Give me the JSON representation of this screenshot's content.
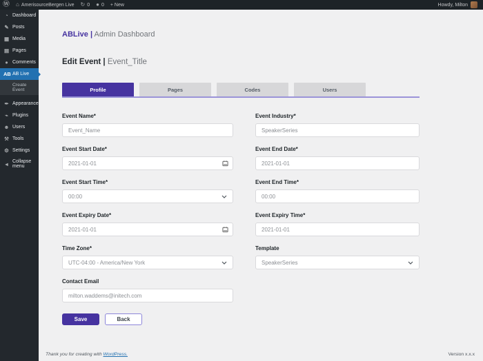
{
  "admin_bar": {
    "wp_logo_glyph": "Ⓦ",
    "home_icon_glyph": "⌂",
    "site_name": "AmerisourceBergen Live",
    "updates_icon_glyph": "↻",
    "updates_count": "0",
    "comments_icon_glyph": "●",
    "comments_count": "0",
    "new_label": "+ New",
    "howdy": "Howdy, Milton"
  },
  "sidebar": {
    "items": [
      {
        "icon": "◔",
        "label": "Dashboard"
      },
      {
        "icon": "✎",
        "label": "Posts"
      },
      {
        "icon": "▦",
        "label": "Media"
      },
      {
        "icon": "▤",
        "label": "Pages"
      },
      {
        "icon": "●",
        "label": "Comments"
      },
      {
        "icon": "AB",
        "label": "AB Live"
      },
      {
        "icon": "✒",
        "label": "Appearance"
      },
      {
        "icon": "⌁",
        "label": "Plugins"
      },
      {
        "icon": "☻",
        "label": "Users"
      },
      {
        "icon": "⚒",
        "label": "Tools"
      },
      {
        "icon": "⚙",
        "label": "Settings"
      },
      {
        "icon": "◄",
        "label": "Collapse menu"
      }
    ],
    "submenu_create_event": "Create Event"
  },
  "header": {
    "brand": "ABLive |",
    "brand_suffix": " Admin Dashboard",
    "page_title": "Edit Event |",
    "page_subtitle": " Event_Title"
  },
  "tabs": [
    {
      "label": "Profile"
    },
    {
      "label": "Pages"
    },
    {
      "label": "Codes"
    },
    {
      "label": "Users"
    }
  ],
  "form": {
    "fields": [
      {
        "label": "Event Name*",
        "value": "Event_Name"
      },
      {
        "label": "Event Industry*",
        "value": "SpeakerSeries"
      },
      {
        "label": "Event Start Date*",
        "value": "2021-01-01"
      },
      {
        "label": "Event End Date*",
        "value": "2021-01-01"
      },
      {
        "label": "Event Start Time*",
        "value": "00:00"
      },
      {
        "label": "Event End Time*",
        "value": "00:00"
      },
      {
        "label": "Event Expiry Date*",
        "value": "2021-01-01"
      },
      {
        "label": "Event Expiry Time*",
        "value": "2021-01-01"
      },
      {
        "label": "Time Zone*",
        "value": "UTC-04:00 - America/New York"
      },
      {
        "label": "Template",
        "value": "SpeakerSeries"
      },
      {
        "label": "Contact Email",
        "value": "milton.waddems@initech.com"
      }
    ]
  },
  "buttons": {
    "save": "Save",
    "back": "Back"
  },
  "footer": {
    "thanks_prefix": "Thank you for creating with ",
    "link": "WordPress.",
    "version": "Version x.x.x"
  },
  "colors": {
    "accent_purple": "#4633a0",
    "tab_underline": "#9a93d8",
    "active_menu_blue": "#2271b1",
    "admin_dark": "#1d2327",
    "sidebar_dark": "#23282d",
    "content_bg": "#f0f0f1",
    "link_blue": "#2271b1"
  }
}
